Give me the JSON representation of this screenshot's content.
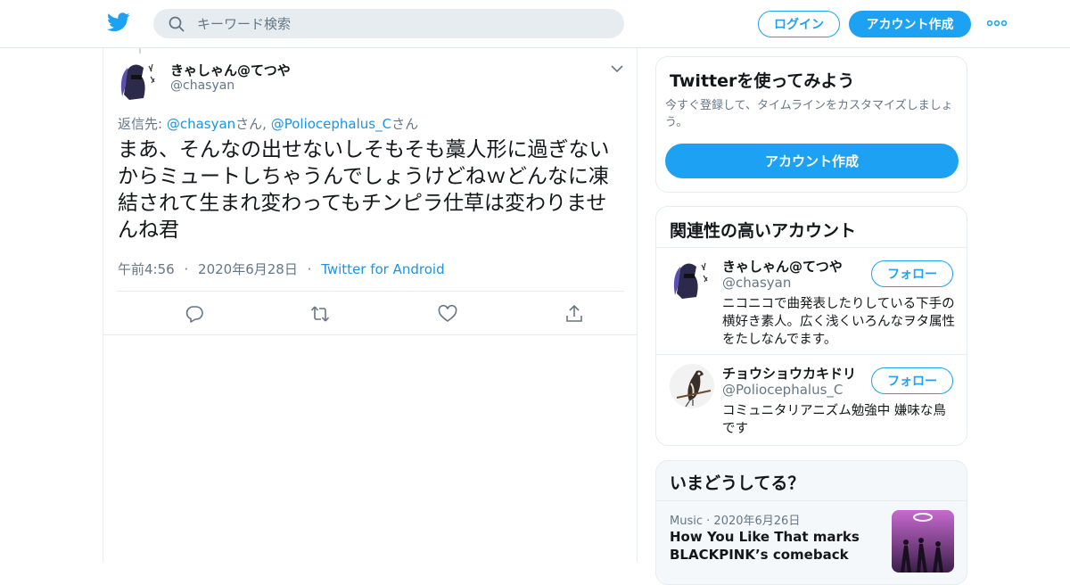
{
  "header": {
    "search_placeholder": "キーワード検索",
    "login_label": "ログイン",
    "signup_label": "アカウント作成"
  },
  "tweet": {
    "author_name": "きゃしゃん@てつや",
    "author_handle": "@chasyan",
    "reply_prefix": "返信先: ",
    "reply_user1": "@chasyan",
    "reply_san1": "さん, ",
    "reply_user2": "@Poliocephalus_C",
    "reply_san2": "さん",
    "text": "まあ、そんなの出せないしそもそも藁人形に過ぎないからミュートしちゃうんでしょうけどねｗどんなに凍結されて生まれ変わってもチンピラ仕草は変わりませんね君",
    "time": "午前4:56",
    "date": "2020年6月28日",
    "app": "Twitter for Android",
    "sep": "·"
  },
  "signup_card": {
    "title": "Twitterを使ってみよう",
    "description": "今すぐ登録して、タイムラインをカスタマイズしましょう。",
    "button": "アカウント作成"
  },
  "related": {
    "title": "関連性の高いアカウント",
    "follow_label": "フォロー",
    "users": [
      {
        "name": "きゃしゃん@てつや",
        "handle": "@chasyan",
        "bio": "ニコニコで曲発表したりしている下手の横好き素人。広く浅くいろんなヲタ属性をたしなんでます。"
      },
      {
        "name": "チョウショウカキドリ",
        "handle": "@Poliocephalus_C",
        "bio": "コミュニタリアニズム勉強中 嫌味な鳥です"
      }
    ]
  },
  "trends": {
    "title": "いまどうしてる？",
    "items": [
      {
        "category": "Music",
        "sep": "·",
        "date": "2020年6月26日",
        "title": "How You Like That marks BLACKPINK’s comeback"
      }
    ]
  },
  "colors": {
    "brand_blue": "#1da1f2",
    "link_blue": "#1b95e0",
    "muted_gray": "#657786",
    "border": "#e6ecf0"
  },
  "icons": [
    "twitter-bird-icon",
    "search-icon",
    "more-dots-icon",
    "chevron-down-icon",
    "reply-icon",
    "retweet-icon",
    "like-icon",
    "share-icon"
  ]
}
